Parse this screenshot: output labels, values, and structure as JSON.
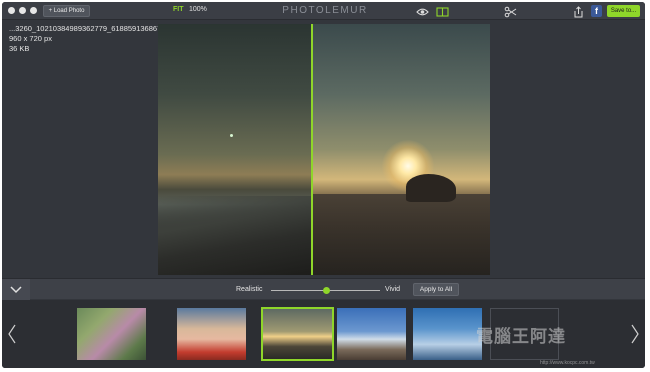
{
  "toolbar": {
    "load_label": "+ Load Photo",
    "fit_label": "FIT",
    "zoom_value": "100%",
    "brand": "PHOTOLEMUR",
    "facebook_label": "f",
    "save_label": "Save to..."
  },
  "file": {
    "name": "...3260_10210384989362779_6188591368677162704_n.jpg",
    "dimensions": "960 x 720  px",
    "size": "36 KB"
  },
  "controls": {
    "realistic_label": "Realistic",
    "vivid_label": "Vivid",
    "apply_label": "Apply to All",
    "slider_value": 0.5
  },
  "thumbnails": {
    "items": [
      {
        "subject": "flowers"
      },
      {
        "subject": "child"
      },
      {
        "subject": "sunset",
        "selected": true
      },
      {
        "subject": "house-sky"
      },
      {
        "subject": "clouds"
      },
      {
        "subject": "empty"
      }
    ]
  },
  "watermark": {
    "text": "電腦王阿達",
    "url": "http://www.kocpc.com.tw"
  },
  "colors": {
    "accent": "#8fd62a",
    "background": "#33363c",
    "toolbar": "#3b3e45"
  },
  "icons": {
    "compare": "eye-icon",
    "split": "split-view-icon",
    "scissors": "scissors-icon",
    "share": "share-icon",
    "collapse": "chevron-down-icon",
    "prev": "chevron-left-icon",
    "next": "chevron-right-icon"
  }
}
